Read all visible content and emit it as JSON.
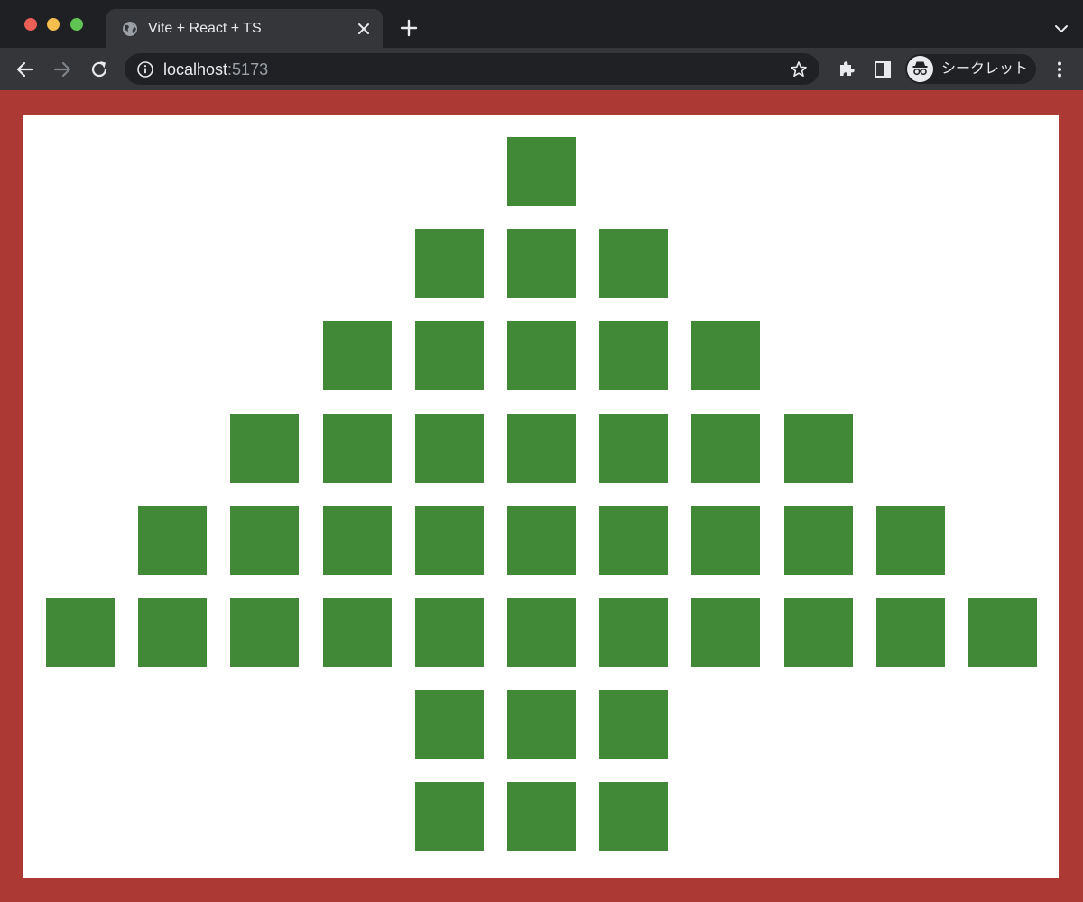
{
  "browser": {
    "tab": {
      "title": "Vite + React + TS"
    },
    "address": {
      "host": "localhost",
      "port": ":5173"
    },
    "profile": {
      "label": "シークレット"
    }
  },
  "icons": {
    "tab": "globe-icon",
    "close": "close-icon",
    "new_tab": "plus-icon",
    "tab_menu": "chevron-down-icon",
    "back": "arrow-left-icon",
    "forward": "arrow-right-icon",
    "reload": "reload-icon",
    "site_info": "info-icon",
    "bookmark": "star-icon",
    "extensions": "puzzle-icon",
    "side_panel": "side-panel-icon",
    "incognito": "incognito-icon",
    "menu": "kebab-menu-icon"
  },
  "colors": {
    "page_border": "#ac3933",
    "page_background": "#ffffff",
    "cell": "#418837"
  },
  "grid": {
    "rows": [
      [
        0,
        0,
        0,
        0,
        0,
        1,
        0,
        0,
        0,
        0,
        0
      ],
      [
        0,
        0,
        0,
        0,
        1,
        1,
        1,
        0,
        0,
        0,
        0
      ],
      [
        0,
        0,
        0,
        1,
        1,
        1,
        1,
        1,
        0,
        0,
        0
      ],
      [
        0,
        0,
        1,
        1,
        1,
        1,
        1,
        1,
        1,
        0,
        0
      ],
      [
        0,
        1,
        1,
        1,
        1,
        1,
        1,
        1,
        1,
        1,
        0
      ],
      [
        1,
        1,
        1,
        1,
        1,
        1,
        1,
        1,
        1,
        1,
        1
      ],
      [
        0,
        0,
        0,
        0,
        1,
        1,
        1,
        0,
        0,
        0,
        0
      ],
      [
        0,
        0,
        0,
        0,
        1,
        1,
        1,
        0,
        0,
        0,
        0
      ]
    ]
  }
}
